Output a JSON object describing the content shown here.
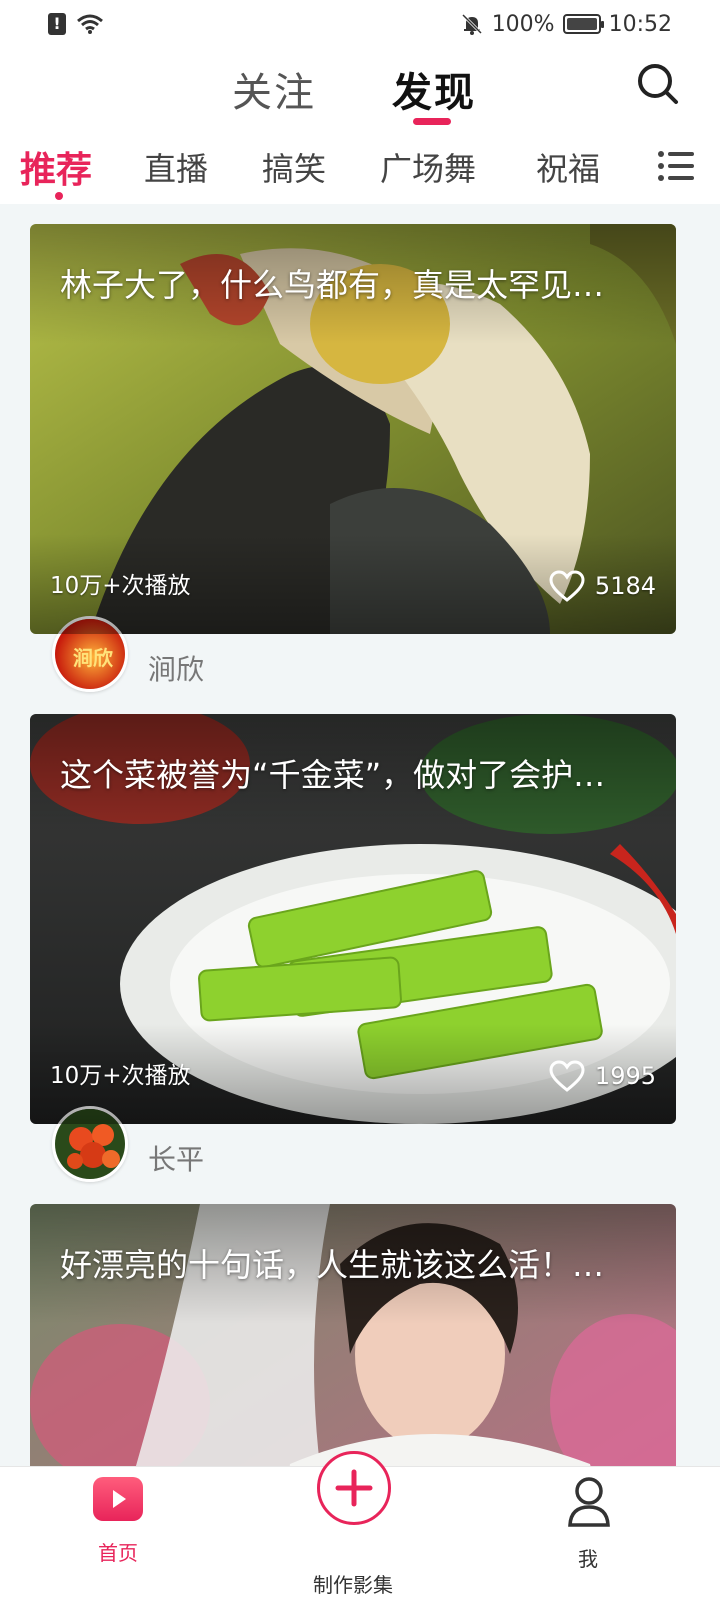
{
  "status_bar": {
    "battery": "100%",
    "time": "10:52"
  },
  "header": {
    "tabs": [
      {
        "label": "关注",
        "active": false
      },
      {
        "label": "发现",
        "active": true
      }
    ],
    "search_icon": "search-icon"
  },
  "categories": {
    "items": [
      "推荐",
      "直播",
      "搞笑",
      "广场舞",
      "祝福"
    ],
    "active_index": 0,
    "menu_icon": "list-menu-icon"
  },
  "feed": [
    {
      "title": "林子大了，什么鸟都有，真是太罕见…",
      "plays": "10万+次播放",
      "likes": "5184",
      "author": "涧欣",
      "avatar_text": "涧欣"
    },
    {
      "title": "这个菜被誉为“千金菜”，做对了会护…",
      "plays": "10万+次播放",
      "likes": "1995",
      "author": "长平"
    },
    {
      "title": "好漂亮的十句话，人生就该这么活！…"
    }
  ],
  "bottom_nav": {
    "home": "首页",
    "create": "制作影集",
    "me": "我"
  },
  "colors": {
    "accent": "#e8245a",
    "background": "#f2f6f7"
  }
}
